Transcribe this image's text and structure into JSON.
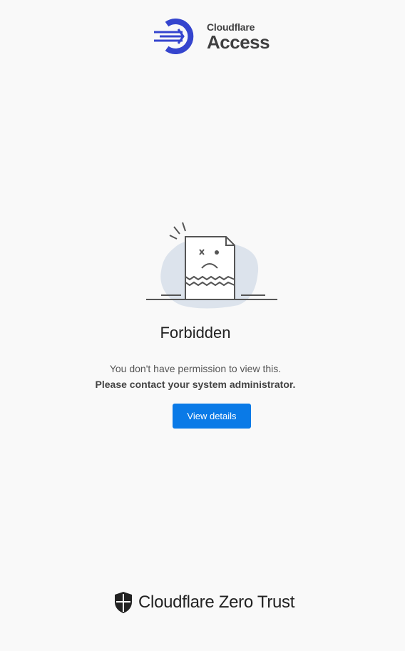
{
  "header": {
    "brand_small": "Cloudflare",
    "brand_big": "Access",
    "logo_icon": "cloudflare-access-logo-icon",
    "accent": "#3545ce"
  },
  "main": {
    "title": "Forbidden",
    "message_line1": "You don't have permission to view this.",
    "message_line2": "Please contact your system administrator.",
    "details_button": "View details",
    "button_color": "#0a7ae7",
    "illustration": "broken-document-illustration"
  },
  "footer": {
    "brand": "Cloudflare Zero Trust",
    "logo_icon": "zero-trust-shield-icon"
  }
}
